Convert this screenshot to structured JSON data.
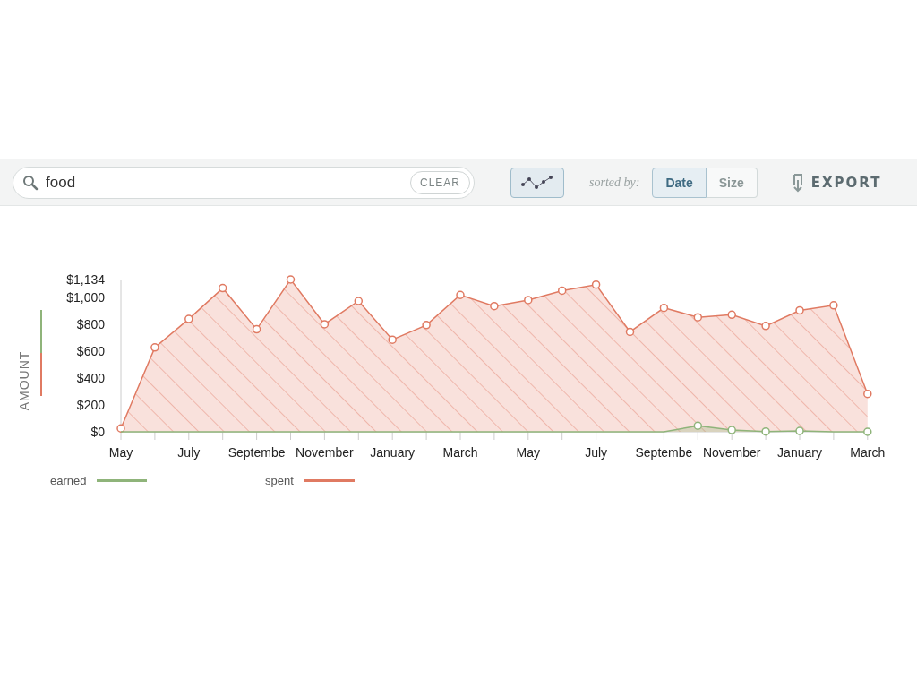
{
  "toolbar": {
    "search": {
      "value": "food",
      "clear_label": "CLEAR"
    },
    "chart_toggle": {
      "selected": true
    },
    "sort_label": "sorted by:",
    "sort_options": [
      {
        "label": "Date",
        "selected": true
      },
      {
        "label": "Size",
        "selected": false
      }
    ],
    "export_label": "EXPORT"
  },
  "chart": {
    "chart_data": {
      "type": "area",
      "ylabel": "AMOUNT",
      "categories": [
        "May",
        null,
        "July",
        null,
        "Septembe",
        null,
        "November",
        null,
        "January",
        null,
        "March",
        null,
        "May",
        null,
        "July",
        null,
        "Septembe",
        null,
        "November",
        null,
        "January",
        null,
        "March"
      ],
      "yticks": [
        {
          "value": 0,
          "label": "$0"
        },
        {
          "value": 200,
          "label": "$200"
        },
        {
          "value": 400,
          "label": "$400"
        },
        {
          "value": 600,
          "label": "$600"
        },
        {
          "value": 800,
          "label": "$800"
        },
        {
          "value": 1000,
          "label": "$1,000"
        },
        {
          "value": 1134,
          "label": "$1,134"
        }
      ],
      "ylim": [
        0,
        1134
      ],
      "series": [
        {
          "name": "earned",
          "color": "#8fb47a",
          "values": [
            0,
            0,
            0,
            0,
            0,
            0,
            0,
            0,
            0,
            0,
            0,
            0,
            0,
            0,
            0,
            0,
            0,
            45,
            13,
            2,
            6,
            0,
            0
          ]
        },
        {
          "name": "spent",
          "color": "#e07a62",
          "values": [
            25,
            628,
            840,
            1070,
            763,
            1134,
            801,
            974,
            686,
            795,
            1019,
            936,
            981,
            1051,
            1096,
            744,
            923,
            853,
            872,
            788,
            904,
            942,
            282
          ]
        }
      ]
    }
  }
}
